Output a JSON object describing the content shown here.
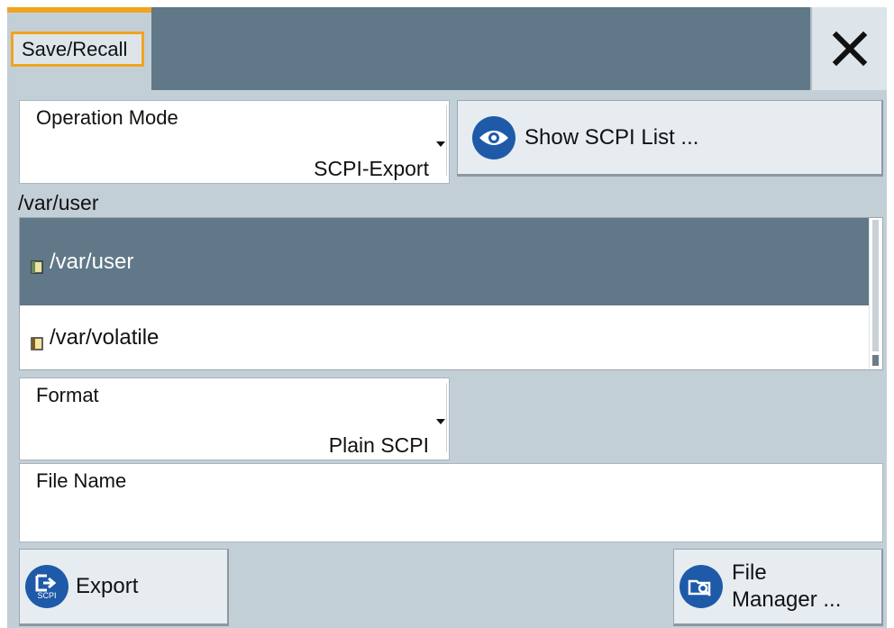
{
  "dialog": {
    "title": "Save/Recall",
    "close_icon": "close-icon"
  },
  "operation_mode": {
    "label": "Operation Mode",
    "value": "SCPI-Export"
  },
  "show_scpi_button": {
    "label": "Show SCPI List ...",
    "icon": "eye-icon"
  },
  "directory": {
    "current_path": "/var/user",
    "items": [
      {
        "label": "/var/user",
        "icon": "folder-icon",
        "selected": true
      },
      {
        "label": "/var/volatile",
        "icon": "folder-icon",
        "selected": false
      }
    ]
  },
  "format": {
    "label": "Format",
    "value": "Plain SCPI"
  },
  "file_name": {
    "label": "File Name",
    "value": ""
  },
  "export_button": {
    "label": "Export",
    "icon": "scpi-export-icon",
    "icon_text": "SCPI"
  },
  "file_manager_button": {
    "label_line1": "File",
    "label_line2": "Manager ...",
    "icon": "file-manager-icon"
  },
  "colors": {
    "header": "#607888",
    "panel": "#c3cfd7",
    "accent": "#f0a420",
    "icon_blue": "#1e5aa8",
    "selected_row": "#607888"
  }
}
